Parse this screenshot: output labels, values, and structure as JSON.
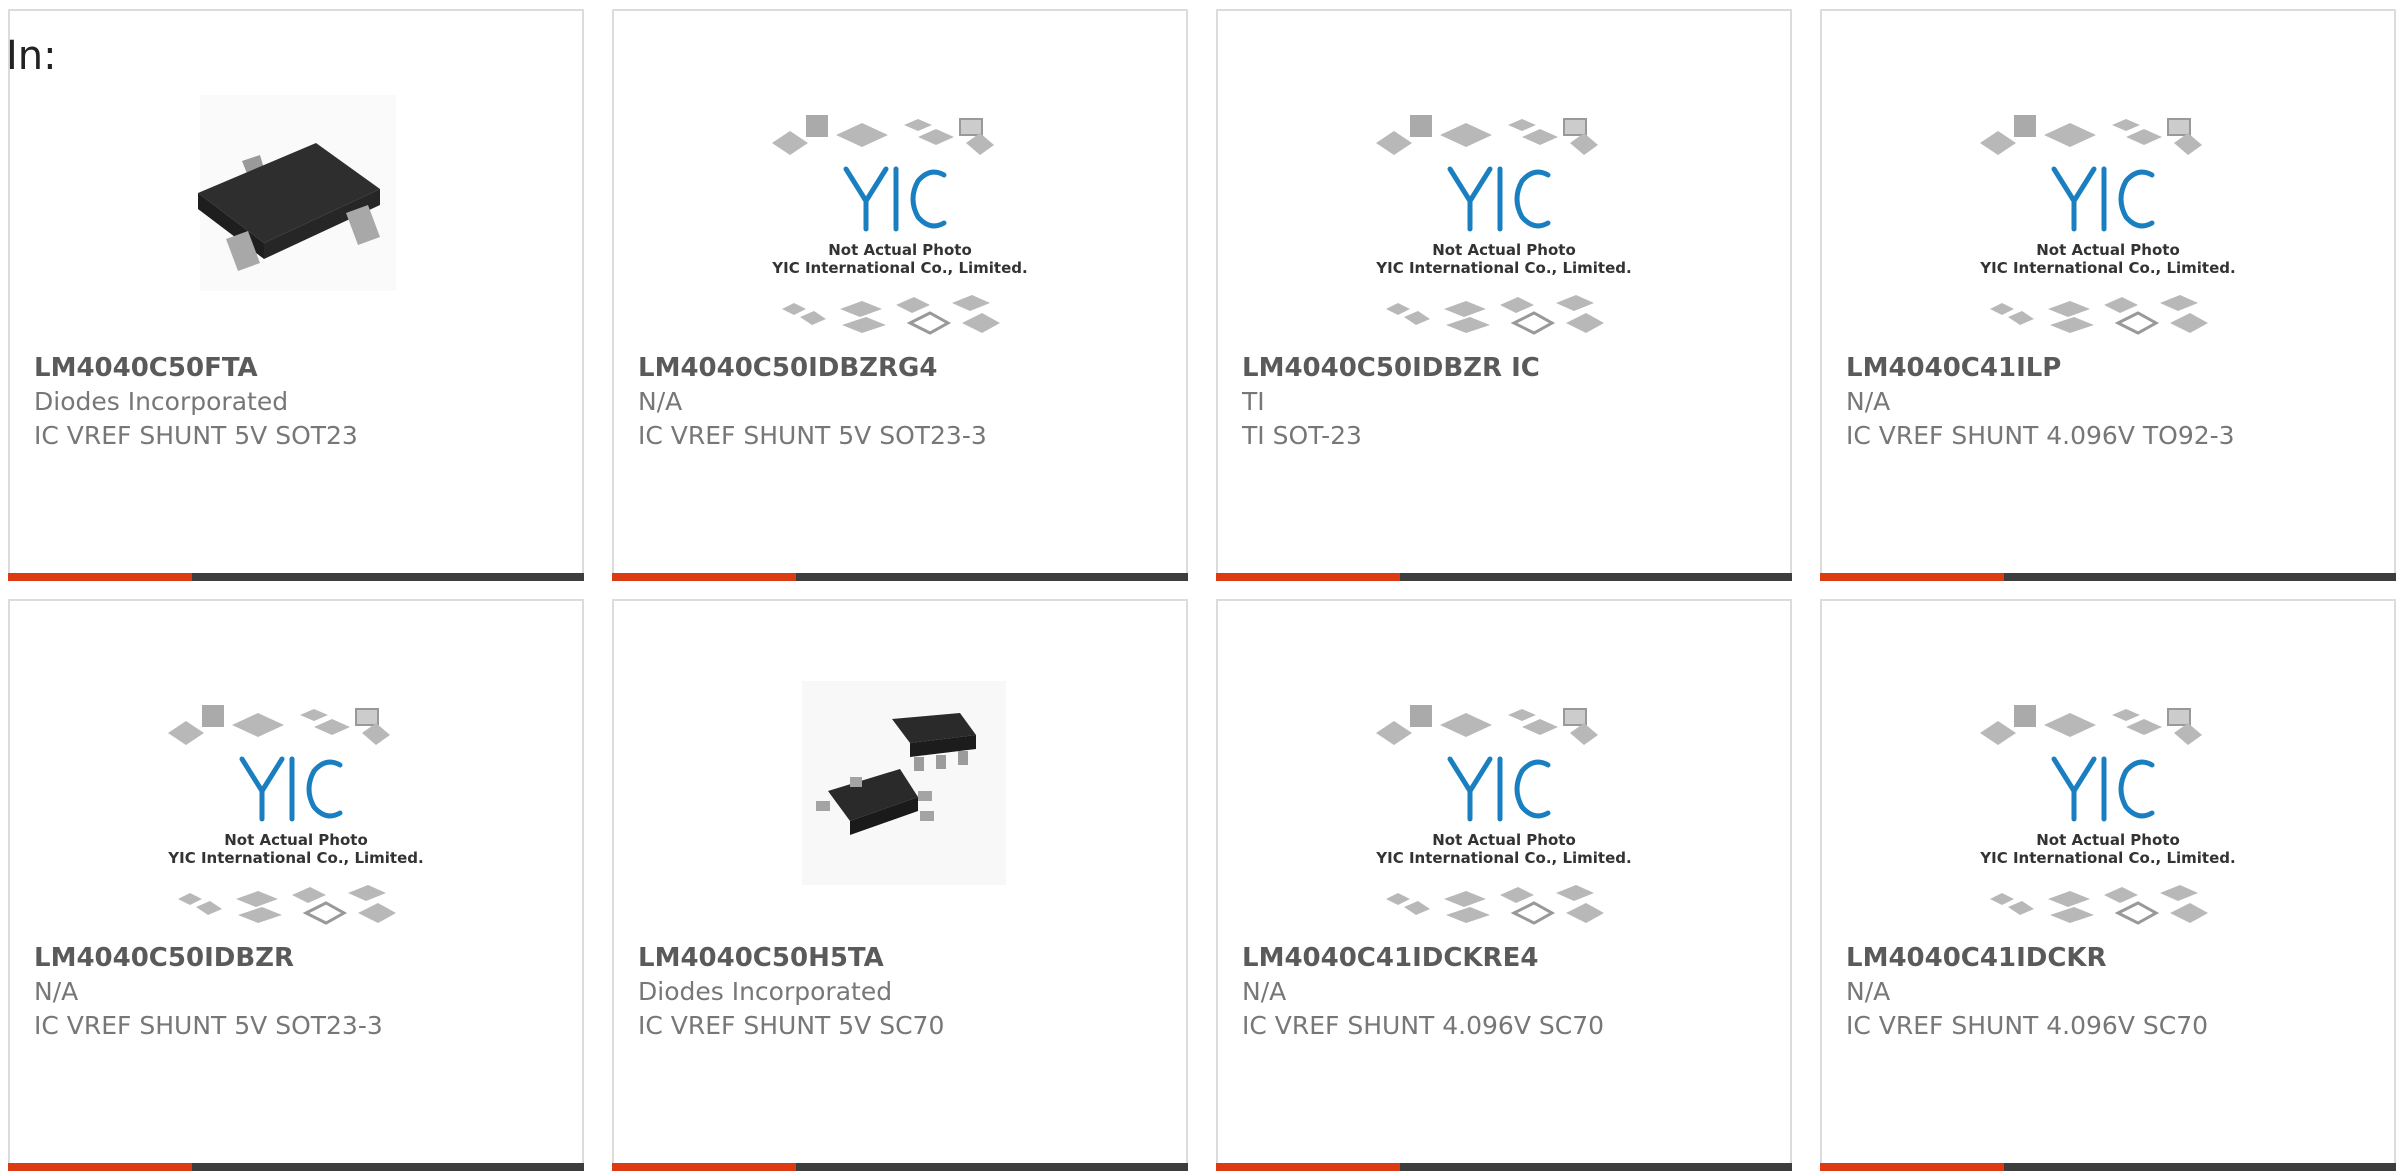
{
  "page": {
    "label": "In:"
  },
  "placeholder": {
    "line1": "Not Actual Photo",
    "line2": "YIC International Co., Limited."
  },
  "colors": {
    "accent": "#dc3a12",
    "bar": "#3d3d3d",
    "border": "#dcdcdc",
    "yic_blue": "#1a7fc1"
  },
  "products": [
    {
      "part": "LM4040C50FTA",
      "maker": "Diodes Incorporated",
      "desc": "IC VREF SHUNT 5V SOT23",
      "image": "sot23-chip-photo"
    },
    {
      "part": "LM4040C50IDBZRG4",
      "maker": "N/A",
      "desc": "IC VREF SHUNT 5V SOT23-3",
      "image": "yic-placeholder"
    },
    {
      "part": "LM4040C50IDBZR IC",
      "maker": "TI",
      "desc": "TI SOT-23",
      "image": "yic-placeholder"
    },
    {
      "part": "LM4040C41ILP",
      "maker": "N/A",
      "desc": "IC VREF SHUNT 4.096V TO92-3",
      "image": "yic-placeholder"
    },
    {
      "part": "LM4040C50IDBZR",
      "maker": "N/A",
      "desc": "IC VREF SHUNT 5V SOT23-3",
      "image": "yic-placeholder"
    },
    {
      "part": "LM4040C50H5TA",
      "maker": "Diodes Incorporated",
      "desc": "IC VREF SHUNT 5V SC70",
      "image": "sc70-chip-photo"
    },
    {
      "part": "LM4040C41IDCKRE4",
      "maker": "N/A",
      "desc": "IC VREF SHUNT 4.096V SC70",
      "image": "yic-placeholder"
    },
    {
      "part": "LM4040C41IDCKR",
      "maker": "N/A",
      "desc": "IC VREF SHUNT 4.096V SC70",
      "image": "yic-placeholder"
    }
  ]
}
